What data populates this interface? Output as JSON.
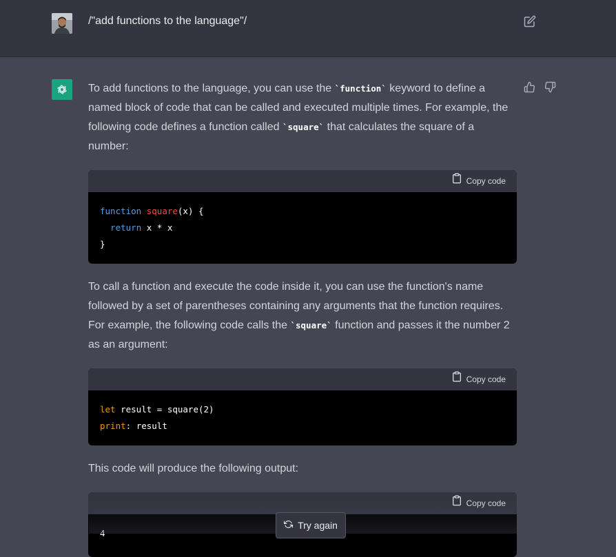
{
  "user_message": "/\"add functions to the language\"/",
  "answer": {
    "p1": {
      "a": "To add functions to the language, you can use the ",
      "code1": "`function`",
      "b": " keyword to define a named block of code that can be called and executed multiple times. For example, the following code defines a function called ",
      "code2": "`square`",
      "c": " that calculates the square of a number:"
    },
    "code1": {
      "copy_label": "Copy code",
      "line1": {
        "kw": "function",
        "name": "square",
        "rest": "(x) {"
      },
      "line2": {
        "indent": "  ",
        "kw": "return",
        "rest": " x * x"
      },
      "line3": "}"
    },
    "p2": {
      "a": "To call a function and execute the code inside it, you can use the function's name followed by a set of parentheses containing any arguments that the function requires. For example, the following code calls the ",
      "code": "`square`",
      "b": " function and passes it the number 2 as an argument:"
    },
    "code2": {
      "copy_label": "Copy code",
      "line1": {
        "kw": "let",
        "rest": " result = square(2)"
      },
      "line2": {
        "kw": "print",
        "rest": ": result"
      }
    },
    "p3": "This code will produce the following output:",
    "code3": {
      "copy_label": "Copy code",
      "line1": "4"
    }
  },
  "try_again_label": "Try again",
  "icons": {
    "edit": "edit-icon",
    "thumbs_up": "thumbs-up-icon",
    "thumbs_down": "thumbs-down-icon",
    "clipboard": "clipboard-icon",
    "refresh": "refresh-icon",
    "logo": "openai-logo-icon"
  },
  "colors": {
    "user_bg": "#343541",
    "assistant_bg": "#444654",
    "logo_bg": "#19a37f",
    "code_bg": "#000000"
  }
}
